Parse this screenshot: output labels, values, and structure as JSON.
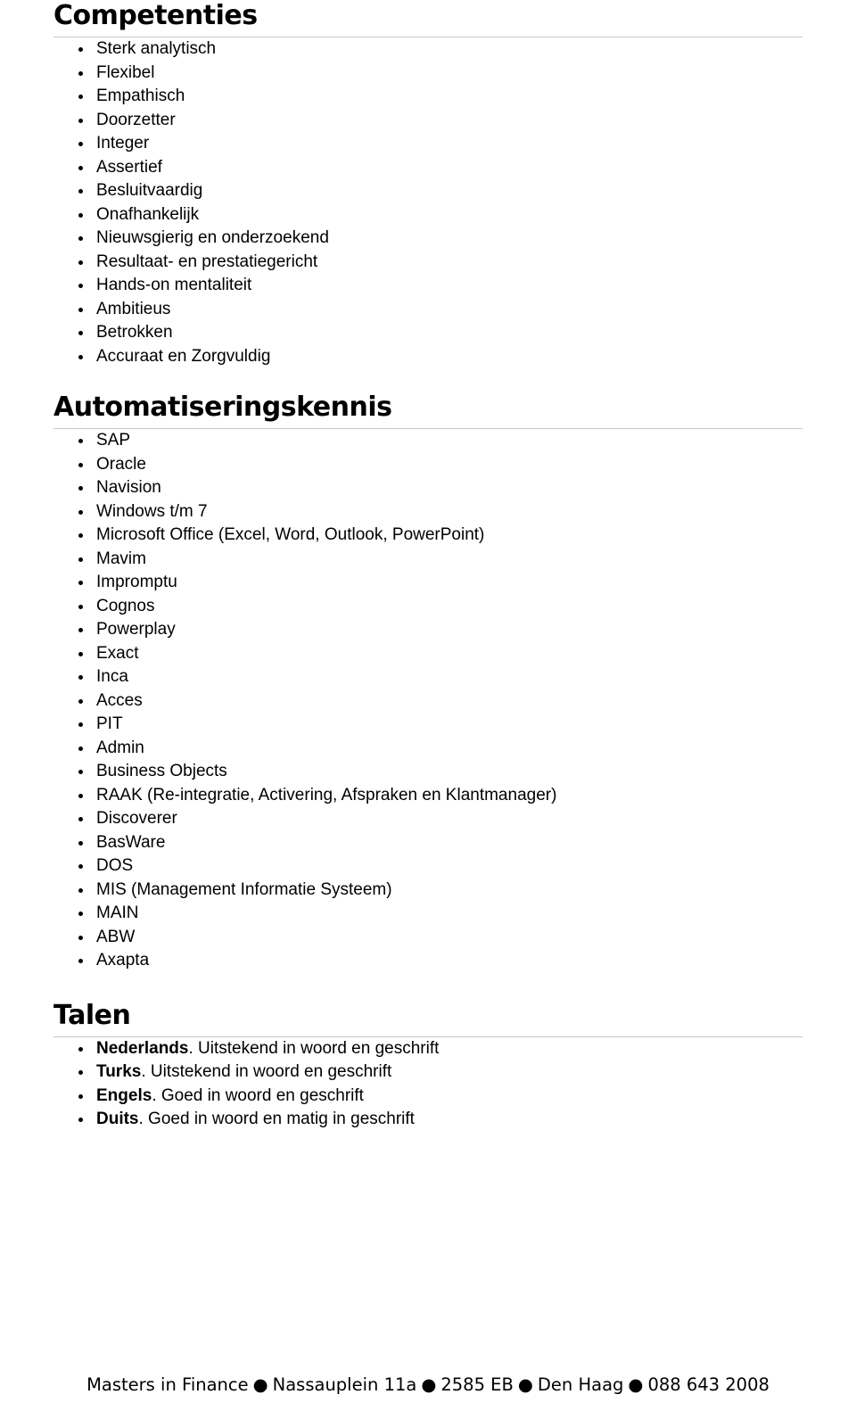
{
  "sections": [
    {
      "heading": "Competenties",
      "items": [
        {
          "text": "Sterk analytisch"
        },
        {
          "text": "Flexibel"
        },
        {
          "text": "Empathisch"
        },
        {
          "text": "Doorzetter"
        },
        {
          "text": "Integer"
        },
        {
          "text": "Assertief"
        },
        {
          "text": "Besluitvaardig"
        },
        {
          "text": "Onafhankelijk"
        },
        {
          "text": "Nieuwsgierig en onderzoekend"
        },
        {
          "text": "Resultaat- en prestatiegericht"
        },
        {
          "text": "Hands-on mentaliteit"
        },
        {
          "text": "Ambitieus"
        },
        {
          "text": "Betrokken"
        },
        {
          "text": "Accuraat en Zorgvuldig"
        }
      ]
    },
    {
      "heading": "Automatiseringskennis",
      "items": [
        {
          "text": "SAP"
        },
        {
          "text": "Oracle"
        },
        {
          "text": "Navision"
        },
        {
          "text": "Windows t/m 7"
        },
        {
          "text": "Microsoft Office (Excel, Word, Outlook, PowerPoint)"
        },
        {
          "text": "Mavim"
        },
        {
          "text": "Impromptu"
        },
        {
          "text": "Cognos"
        },
        {
          "text": "Powerplay"
        },
        {
          "text": "Exact"
        },
        {
          "text": "Inca"
        },
        {
          "text": "Acces"
        },
        {
          "text": "PIT"
        },
        {
          "text": "Admin"
        },
        {
          "text": "Business Objects"
        },
        {
          "text": "RAAK (Re-integratie, Activering, Afspraken en Klantmanager)"
        },
        {
          "text": "Discoverer"
        },
        {
          "text": "BasWare"
        },
        {
          "text": "DOS"
        },
        {
          "text": "MIS (Management Informatie Systeem)"
        },
        {
          "text": "MAIN"
        },
        {
          "text": "ABW"
        },
        {
          "text": "Axapta"
        }
      ]
    },
    {
      "heading": "Talen",
      "items": [
        {
          "bold": "Nederlands",
          "text": ". Uitstekend in woord en geschrift"
        },
        {
          "bold": "Turks",
          "text": ". Uitstekend in woord en geschrift"
        },
        {
          "bold": "Engels",
          "text": ". Goed in woord en geschrift"
        },
        {
          "bold": "Duits",
          "text": ". Goed in woord en matig in geschrift"
        }
      ]
    }
  ],
  "footer": {
    "company": "Masters in Finance",
    "street": "Nassauplein 11a",
    "postcode": "2585 EB",
    "city": "Den Haag",
    "phone": "088 643 2008"
  }
}
